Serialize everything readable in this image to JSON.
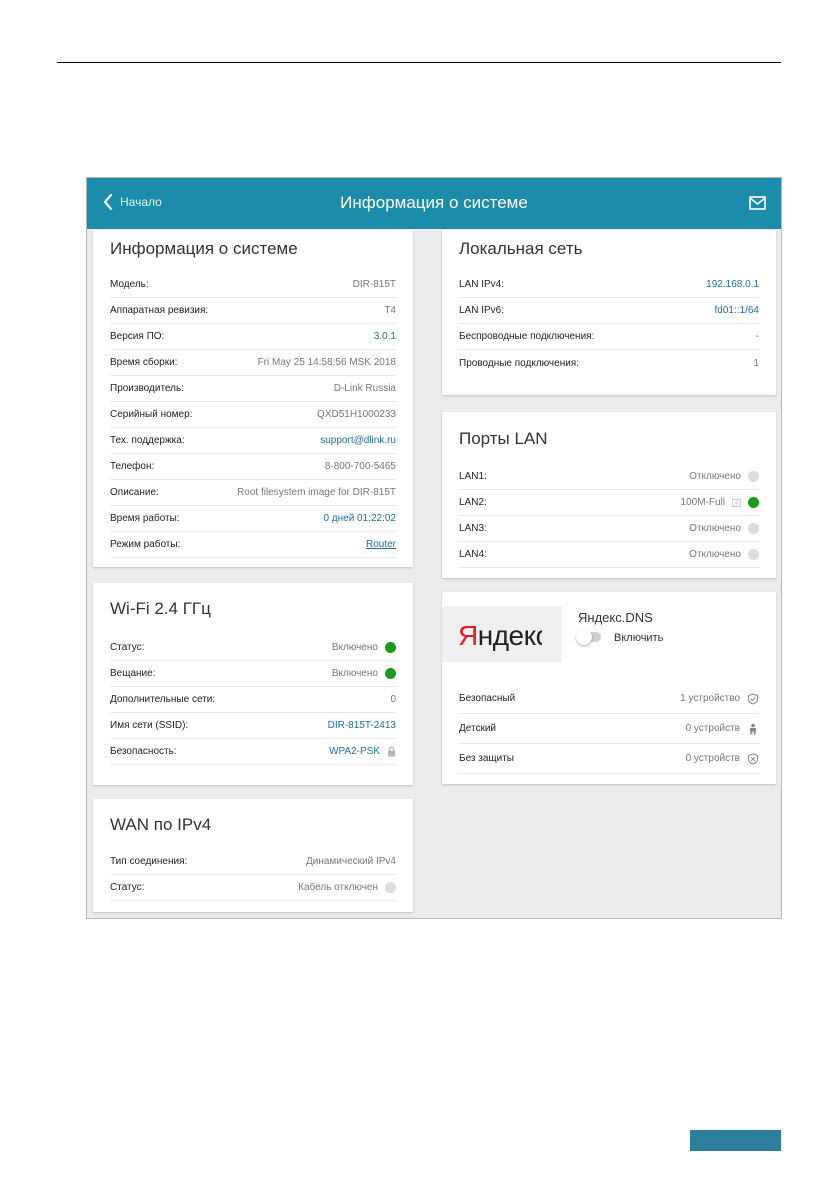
{
  "header": {
    "back_label": "Начало",
    "title": "Информация о системе"
  },
  "system_info": {
    "title": "Информация о системе",
    "rows": [
      {
        "label": "Модель:",
        "value": "DIR-815T"
      },
      {
        "label": "Аппаратная ревизия:",
        "value": "T4"
      },
      {
        "label": "Версия ПО:",
        "value": "3.0.1"
      },
      {
        "label": "Время сборки:",
        "value": "Fri May 25 14:58:56 MSK 2018"
      },
      {
        "label": "Производитель:",
        "value": "D-Link Russia"
      },
      {
        "label": "Серийный номер:",
        "value": "QXD51H1000233"
      },
      {
        "label": "Тех. поддержка:",
        "value": "support@dlink.ru"
      },
      {
        "label": "Телефон:",
        "value": "8-800-700-5465"
      },
      {
        "label": "Описание:",
        "value": "Root filesystem image for DIR-815T"
      },
      {
        "label": "Время работы:",
        "value": "0 дней 01:22:02"
      },
      {
        "label": "Режим работы:",
        "value": "Router"
      }
    ]
  },
  "wifi": {
    "title": "Wi-Fi 2.4 ГГц",
    "rows": [
      {
        "label": "Статус:",
        "value": "Включено"
      },
      {
        "label": "Вещание:",
        "value": "Включено"
      },
      {
        "label": "Дополнительные сети:",
        "value": "0"
      },
      {
        "label": "Имя сети (SSID):",
        "value": "DIR-815T-2413"
      },
      {
        "label": "Безопасность:",
        "value": "WPA2-PSK"
      }
    ]
  },
  "wan": {
    "title": "WAN по IPv4",
    "rows": [
      {
        "label": "Тип соединения:",
        "value": "Динамический IPv4"
      },
      {
        "label": "Статус:",
        "value": "Кабель отключен"
      }
    ]
  },
  "lan": {
    "title": "Локальная сеть",
    "rows": [
      {
        "label": "LAN IPv4:",
        "value": "192.168.0.1"
      },
      {
        "label": "LAN IPv6:",
        "value": "fd01::1/64"
      },
      {
        "label": "Беспроводные подключения:",
        "value": "-"
      },
      {
        "label": "Проводные подключения:",
        "value": "1"
      }
    ]
  },
  "ports": {
    "title": "Порты LAN",
    "rows": [
      {
        "label": "LAN1:",
        "value": "Отключено",
        "status": "off"
      },
      {
        "label": "LAN2:",
        "value": "100M-Full",
        "status": "on"
      },
      {
        "label": "LAN3:",
        "value": "Отключено",
        "status": "off"
      },
      {
        "label": "LAN4:",
        "value": "Отключено",
        "status": "off"
      }
    ]
  },
  "yandex": {
    "logo_y": "Я",
    "logo_rest": "ндекс",
    "title": "Яндекс.DNS",
    "enable_label": "Включить",
    "rows": [
      {
        "label": "Безопасный",
        "value": "1 устройство"
      },
      {
        "label": "Детский",
        "value": "0 устройств"
      },
      {
        "label": "Без защиты",
        "value": "0 устройств"
      }
    ]
  },
  "colors": {
    "header": "#1b8ca9",
    "link": "#1d6ea8",
    "status_on": "#1b9a1b",
    "status_off": "#dcdcdc"
  }
}
